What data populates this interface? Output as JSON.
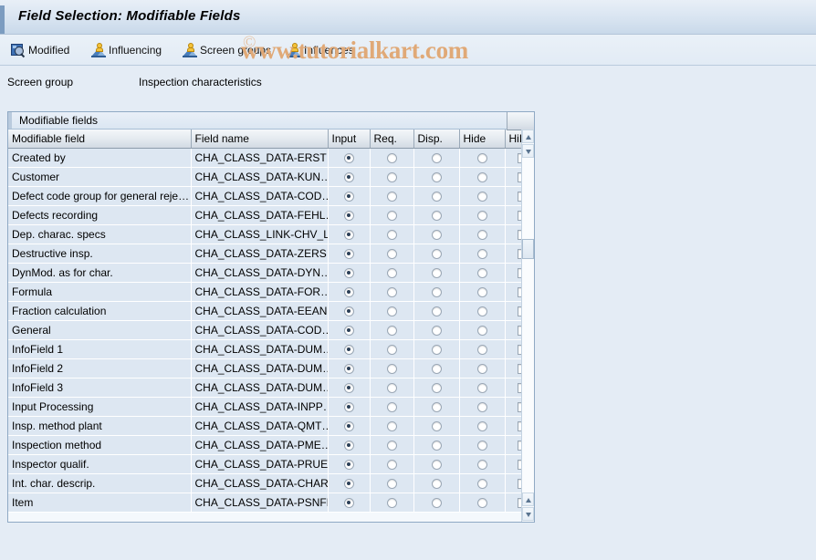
{
  "window": {
    "title": "Field Selection: Modifiable Fields"
  },
  "toolbar": {
    "buttons": [
      {
        "label": "Modified",
        "icon": "magnifier-square-icon"
      },
      {
        "label": "Influencing",
        "icon": "person-mountain-icon"
      },
      {
        "label": "Screen groups",
        "icon": "person-mountain-icon"
      },
      {
        "label": "Influences",
        "icon": "person-mountain-icon"
      }
    ]
  },
  "watermark": {
    "text": "www.tutorialkart.com",
    "copyright": "©",
    "color": "#e0a977"
  },
  "screen_group": {
    "label": "Screen group",
    "value": "Inspection characteristics"
  },
  "panel": {
    "header": "Modifiable fields",
    "columns": [
      "Modifiable field",
      "Field name",
      "Input",
      "Req.",
      "Disp.",
      "Hide",
      "HiLi"
    ],
    "rows": [
      {
        "field": "Created by",
        "name": "CHA_CLASS_DATA-ERST…",
        "input": true,
        "req": false,
        "disp": false,
        "hide": false,
        "hili": false
      },
      {
        "field": "Customer",
        "name": "CHA_CLASS_DATA-KUN…",
        "input": true,
        "req": false,
        "disp": false,
        "hide": false,
        "hili": false
      },
      {
        "field": "Defect code group for general reje…",
        "name": "CHA_CLASS_DATA-COD…",
        "input": true,
        "req": false,
        "disp": false,
        "hide": false,
        "hili": false
      },
      {
        "field": "Defects recording",
        "name": "CHA_CLASS_DATA-FEHL…",
        "input": true,
        "req": false,
        "disp": false,
        "hide": false,
        "hili": false
      },
      {
        "field": "Dep. charac. specs",
        "name": "CHA_CLASS_LINK-CHV_L…",
        "input": true,
        "req": false,
        "disp": false,
        "hide": false,
        "hili": false
      },
      {
        "field": "Destructive insp.",
        "name": "CHA_CLASS_DATA-ZERS…",
        "input": true,
        "req": false,
        "disp": false,
        "hide": false,
        "hili": false
      },
      {
        "field": "DynMod. as for char.",
        "name": "CHA_CLASS_DATA-DYN…",
        "input": true,
        "req": false,
        "disp": false,
        "hide": false,
        "hili": false
      },
      {
        "field": "Formula",
        "name": "CHA_CLASS_DATA-FOR…",
        "input": true,
        "req": false,
        "disp": false,
        "hide": false,
        "hili": false
      },
      {
        "field": "Fraction calculation",
        "name": "CHA_CLASS_DATA-EEAN…",
        "input": true,
        "req": false,
        "disp": false,
        "hide": false,
        "hili": false
      },
      {
        "field": "General",
        "name": "CHA_CLASS_DATA-COD…",
        "input": true,
        "req": false,
        "disp": false,
        "hide": false,
        "hili": false
      },
      {
        "field": "InfoField 1",
        "name": "CHA_CLASS_DATA-DUM…",
        "input": true,
        "req": false,
        "disp": false,
        "hide": false,
        "hili": false
      },
      {
        "field": "InfoField 2",
        "name": "CHA_CLASS_DATA-DUM…",
        "input": true,
        "req": false,
        "disp": false,
        "hide": false,
        "hili": false
      },
      {
        "field": "InfoField 3",
        "name": "CHA_CLASS_DATA-DUM…",
        "input": true,
        "req": false,
        "disp": false,
        "hide": false,
        "hili": false
      },
      {
        "field": "Input Processing",
        "name": "CHA_CLASS_DATA-INPP…",
        "input": true,
        "req": false,
        "disp": false,
        "hide": false,
        "hili": false
      },
      {
        "field": "Insp. method plant",
        "name": "CHA_CLASS_DATA-QMT…",
        "input": true,
        "req": false,
        "disp": false,
        "hide": false,
        "hili": false
      },
      {
        "field": "Inspection method",
        "name": "CHA_CLASS_DATA-PME…",
        "input": true,
        "req": false,
        "disp": false,
        "hide": false,
        "hili": false
      },
      {
        "field": "Inspector qualif.",
        "name": "CHA_CLASS_DATA-PRUE…",
        "input": true,
        "req": false,
        "disp": false,
        "hide": false,
        "hili": false
      },
      {
        "field": "Int. char. descrip.",
        "name": "CHA_CLASS_DATA-CHAR…",
        "input": true,
        "req": false,
        "disp": false,
        "hide": false,
        "hili": false
      },
      {
        "field": "Item",
        "name": "CHA_CLASS_DATA-PSNFH",
        "input": true,
        "req": false,
        "disp": false,
        "hide": false,
        "hili": false
      }
    ]
  },
  "scrollbar": {
    "up_icon": "scroll-up-arrow-icon",
    "down_icon": "scroll-down-arrow-icon"
  }
}
